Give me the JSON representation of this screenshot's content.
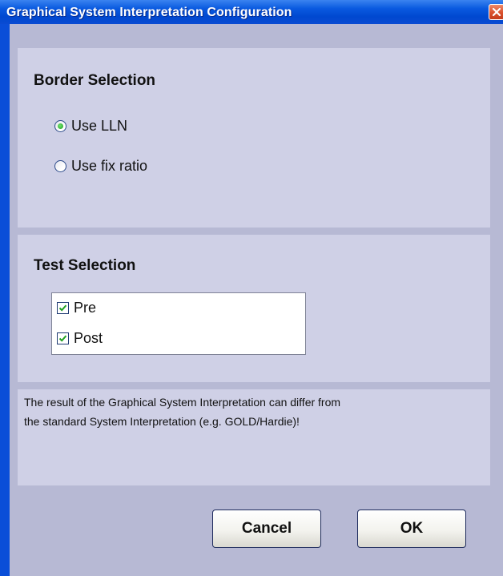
{
  "window": {
    "title": "Graphical System Interpretation Configuration",
    "close_icon": "close-icon"
  },
  "border_selection": {
    "heading": "Border Selection",
    "options": [
      {
        "label": "Use LLN",
        "selected": true
      },
      {
        "label": "Use fix ratio",
        "selected": false
      }
    ]
  },
  "test_selection": {
    "heading": "Test Selection",
    "items": [
      {
        "label": "Pre",
        "checked": true
      },
      {
        "label": "Post",
        "checked": true
      }
    ]
  },
  "note": {
    "line1": "The result of the Graphical System Interpretation can differ from",
    "line2": "the standard System Interpretation (e.g. GOLD/Hardie)!"
  },
  "buttons": {
    "cancel_label": "Cancel",
    "ok_label": "OK"
  },
  "colors": {
    "titlebar": "#0a4ed8",
    "client_bg": "#b7b9d4",
    "panel_bg": "#cfd0e6",
    "radio_selected": "#21a121",
    "checkmark": "#21a121"
  }
}
